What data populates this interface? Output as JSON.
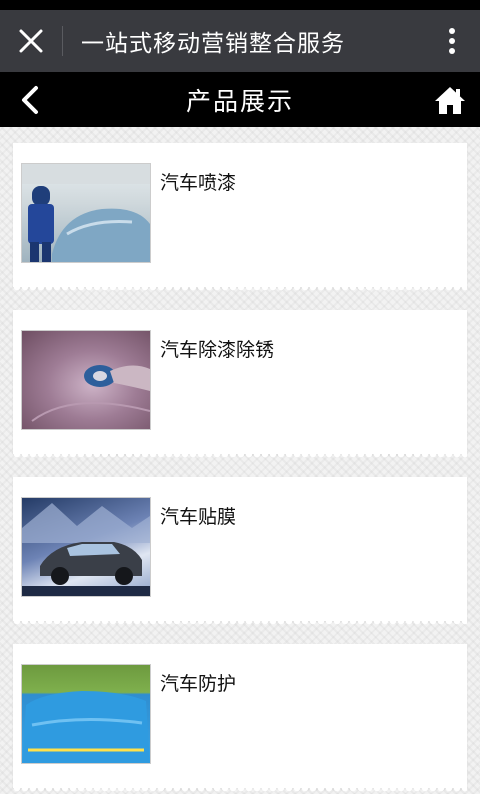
{
  "wechat_bar": {
    "title": "一站式移动营销整合服务"
  },
  "header": {
    "title": "产品展示"
  },
  "products": [
    {
      "title": "汽车喷漆",
      "image_alt": "car spray painting"
    },
    {
      "title": "汽车除漆除锈",
      "image_alt": "paint and rust removal"
    },
    {
      "title": "汽车贴膜",
      "image_alt": "car window film"
    },
    {
      "title": "汽车防护",
      "image_alt": "car protective cover"
    }
  ],
  "colors": {
    "wechat_bar": "#393a3f",
    "header": "#000000",
    "card": "#ffffff"
  }
}
